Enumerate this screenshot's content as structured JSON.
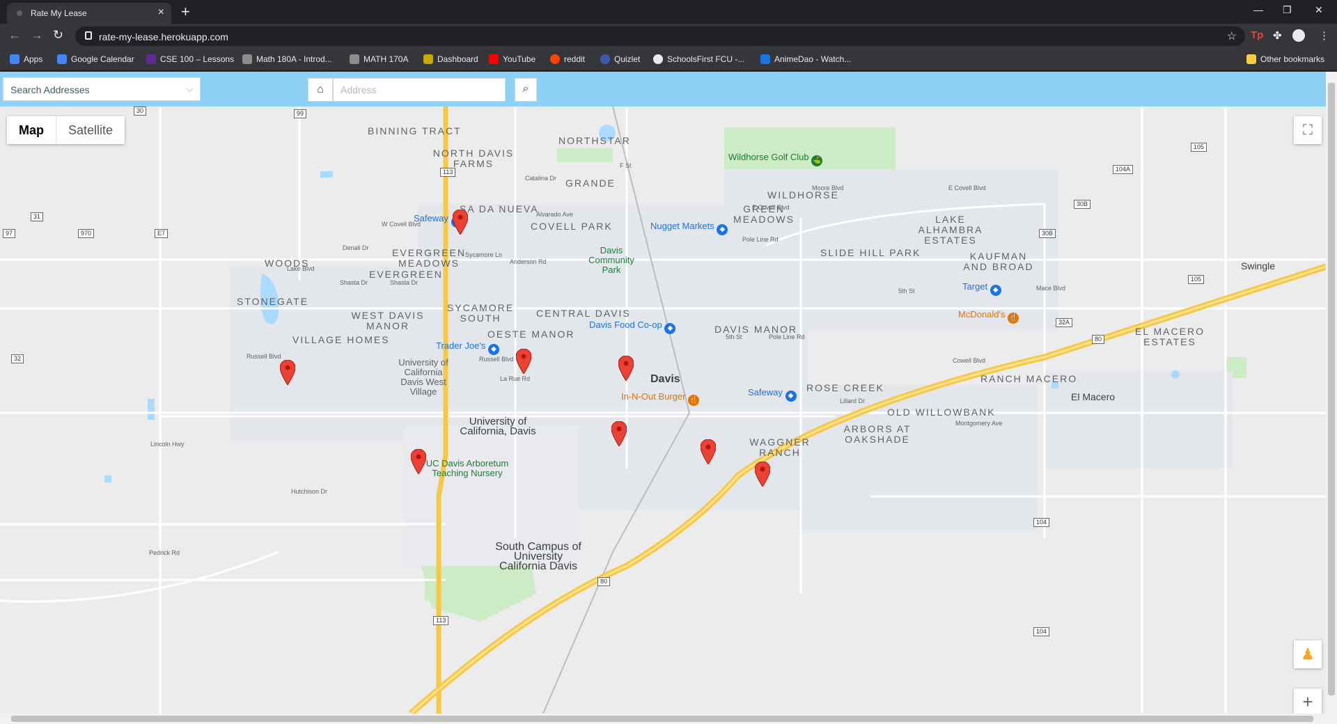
{
  "browser": {
    "tab_title": "Rate My Lease",
    "url": "rate-my-lease.herokuapp.com",
    "bookmarks": [
      {
        "label": "Apps",
        "color": "#4285f4"
      },
      {
        "label": "Google Calendar",
        "color": "#4285f4"
      },
      {
        "label": "CSE 100 – Lessons",
        "color": "#5c2d91"
      },
      {
        "label": "Math 180A - Introd...",
        "color": "#8d8d8d"
      },
      {
        "label": "MATH 170A",
        "color": "#8d8d8d"
      },
      {
        "label": "Dashboard",
        "color": "#c6a800"
      },
      {
        "label": "YouTube",
        "color": "#ff0000"
      },
      {
        "label": "reddit",
        "color": "#ff4500"
      },
      {
        "label": "Quizlet",
        "color": "#4257b2"
      },
      {
        "label": "SchoolsFirst FCU -...",
        "color": "#e8eaed"
      },
      {
        "label": "AnimeDao - Watch...",
        "color": "#1a73e8"
      }
    ],
    "other_bookmarks": "Other bookmarks"
  },
  "header": {
    "search_select_label": "Search Addresses",
    "address_placeholder": "Address"
  },
  "map": {
    "type_buttons": [
      "Map",
      "Satellite"
    ],
    "places": [
      "Binning Tract",
      "Northstar",
      "North Davis Farms",
      "Grande",
      "Sa da Nueva",
      "Covell Park",
      "Wildhorse",
      "Green Meadows",
      "Lake Alhambra Estates",
      "Slide Hill Park",
      "Kaufman and Broad",
      "Evergreen Meadows",
      "Woods",
      "Evergreen",
      "Stonegate",
      "West Davis Manor",
      "Village Homes",
      "Sycamore South",
      "Central Davis",
      "Oeste Manor",
      "Davis Manor",
      "El Macero Estates",
      "Rose Creek",
      "Ranch Macero",
      "Old Willowbank",
      "Arbors at Oakshade",
      "Waggner Ranch"
    ],
    "city_labels": [
      "Davis",
      "Swingle",
      "El Macero"
    ],
    "pois": [
      {
        "label": "Wildhorse Golf Club",
        "color": "#188038"
      },
      {
        "label": "Safeway",
        "color": "#1a73e8"
      },
      {
        "label": "Nugget Markets",
        "color": "#1a73e8"
      },
      {
        "label": "Davis Community Park",
        "color": "#188038"
      },
      {
        "label": "Target",
        "color": "#1a73e8"
      },
      {
        "label": "McDonald's",
        "color": "#e37400"
      },
      {
        "label": "Davis Food Co-op",
        "color": "#1a73e8"
      },
      {
        "label": "Trader Joe's",
        "color": "#1a73e8"
      },
      {
        "label": "University of California Davis West Village",
        "color": "#5f6368"
      },
      {
        "label": "In-N-Out Burger",
        "color": "#e37400"
      },
      {
        "label": "Safeway",
        "color": "#1a73e8"
      },
      {
        "label": "University of California, Davis",
        "color": "#3c4043"
      },
      {
        "label": "UC Davis Arboretum Teaching Nursery",
        "color": "#188038"
      },
      {
        "label": "South Campus of University California Davis",
        "color": "#3c4043"
      }
    ],
    "streets": [
      "W Covell Blvd",
      "Alvarado Ave",
      "E Covell Blvd",
      "Moore Blvd",
      "Russell Blvd",
      "Hutchison Dr",
      "5th St",
      "Cowell Blvd",
      "Montgomery Ave",
      "Lillard Dr",
      "Shasta Dr",
      "Lake Blvd",
      "Denali Dr",
      "Sycamore Ln",
      "Anderson Rd",
      "F St",
      "Pole Line Rd",
      "Mace Blvd",
      "La Rue Rd",
      "Lincoln Hwy",
      "Pedrick Rd",
      "Catalina Dr"
    ],
    "shields": [
      "30",
      "99",
      "113",
      "31",
      "97",
      "970",
      "E7",
      "32",
      "105",
      "104A",
      "30B",
      "30B",
      "105",
      "32A",
      "80",
      "80",
      "104",
      "104",
      "113"
    ],
    "marker_count": 8
  }
}
